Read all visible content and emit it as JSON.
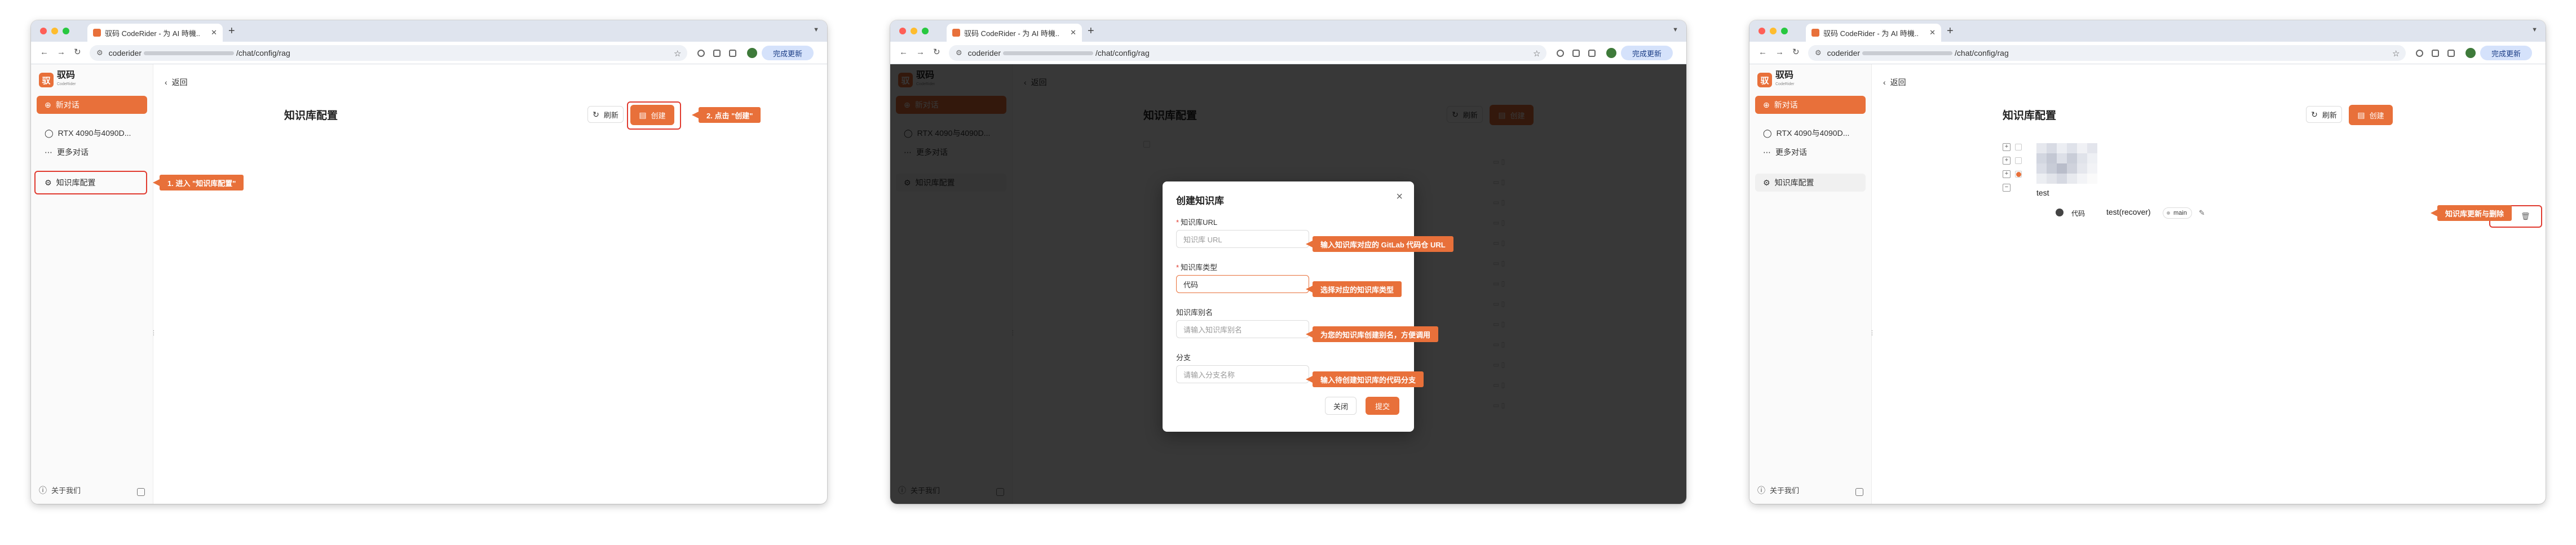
{
  "browser": {
    "tab_title": "驭码 CodeRider - 为 AI 時機..",
    "url_host": "coderider",
    "url_path": "/chat/config/rag",
    "update_label": "完成更新"
  },
  "sidebar": {
    "logo_mark": "驭",
    "logo_name": "驭码",
    "logo_sub": "CodeRider",
    "new_chat": "新对话",
    "chat_item": "RTX 4090与4090D...",
    "more_chats": "更多对话",
    "kb_config": "知识库配置",
    "about": "关于我们"
  },
  "main": {
    "back": "返回",
    "title": "知识库配置",
    "refresh": "刷新",
    "create": "创建"
  },
  "callouts": {
    "step1": "1. 进入 \"知识库配置\"",
    "step2": "2. 点击 \"创建\"",
    "url_hint": "输入知识库对应的 GitLab 代码仓 URL",
    "type_hint": "选择对应的知识库类型",
    "alias_hint": "为您的知识库创建别名，方便调用",
    "branch_hint": "输入待创建知识库的代码分支",
    "actions_hint": "知识库更新与删除"
  },
  "modal": {
    "title": "创建知识库",
    "url_label": "知识库URL",
    "url_placeholder": "知识库 URL",
    "type_label": "知识库类型",
    "type_value": "代码",
    "alias_label": "知识库别名",
    "alias_placeholder": "请输入知识库别名",
    "branch_label": "分支",
    "branch_placeholder": "请输入分支名称",
    "cancel": "关闭",
    "submit": "提交"
  },
  "kb_list": {
    "name": "test",
    "type": "代码",
    "alias": "test(recover)",
    "branch": "main"
  },
  "colors": {
    "accent": "#e8703a",
    "highlight": "#e03a2f"
  }
}
